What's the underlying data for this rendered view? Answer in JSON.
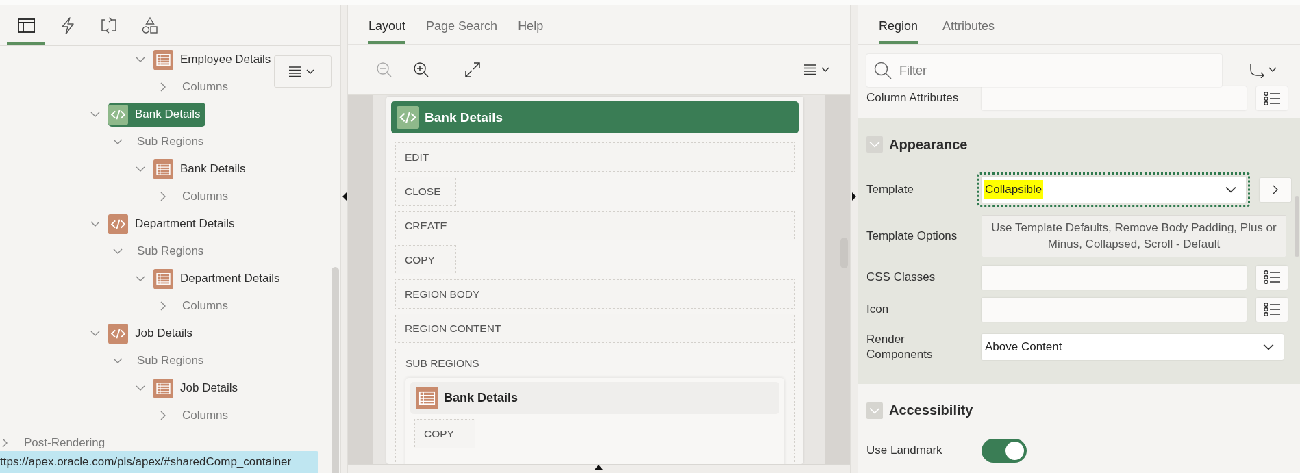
{
  "navigator": {
    "tabs": [
      {
        "kind": "rendering",
        "selected": true
      },
      {
        "kind": "dynamic-actions",
        "selected": false
      },
      {
        "kind": "processing",
        "selected": false
      },
      {
        "kind": "shared-components",
        "selected": false
      }
    ],
    "tree": [
      {
        "label": "Employee Details",
        "kind": "table",
        "expanded": true,
        "selected": false,
        "children": [
          {
            "label": "Columns",
            "kind": "folder",
            "expanded": false,
            "selected": false
          }
        ]
      },
      {
        "label": "Bank Details",
        "kind": "region",
        "expanded": true,
        "selected": true,
        "children": [
          {
            "label": "Sub Regions",
            "kind": "folder",
            "expanded": true,
            "selected": false,
            "children": [
              {
                "label": "Bank Details",
                "kind": "table",
                "expanded": true,
                "selected": false,
                "children": [
                  {
                    "label": "Columns",
                    "kind": "folder",
                    "expanded": false,
                    "selected": false
                  }
                ]
              }
            ]
          }
        ]
      },
      {
        "label": "Department Details",
        "kind": "region",
        "expanded": true,
        "selected": false,
        "children": [
          {
            "label": "Sub Regions",
            "kind": "folder",
            "expanded": true,
            "selected": false,
            "children": [
              {
                "label": "Department Details",
                "kind": "table",
                "expanded": true,
                "selected": false,
                "children": [
                  {
                    "label": "Columns",
                    "kind": "folder",
                    "expanded": false,
                    "selected": false
                  }
                ]
              }
            ]
          }
        ]
      },
      {
        "label": "Job Details",
        "kind": "region",
        "expanded": true,
        "selected": false,
        "children": [
          {
            "label": "Sub Regions",
            "kind": "folder",
            "expanded": true,
            "selected": false,
            "children": [
              {
                "label": "Job Details",
                "kind": "table",
                "expanded": true,
                "selected": false,
                "children": [
                  {
                    "label": "Columns",
                    "kind": "folder",
                    "expanded": false,
                    "selected": false
                  }
                ]
              }
            ]
          }
        ]
      },
      {
        "label": "Post-Rendering",
        "kind": "section",
        "expanded": false,
        "selected": false
      }
    ],
    "status_url": "ttps://apex.oracle.com/pls/apex/#sharedComp_container"
  },
  "layout": {
    "tabs": [
      {
        "label": "Layout",
        "selected": true
      },
      {
        "label": "Page Search",
        "selected": false
      },
      {
        "label": "Help",
        "selected": false
      }
    ],
    "toolbar": [
      {
        "kind": "zoom-out",
        "disabled": true
      },
      {
        "kind": "zoom-in",
        "disabled": false
      },
      {
        "kind": "expand",
        "disabled": false
      }
    ],
    "region": {
      "title": "Bank Details",
      "kind": "region",
      "selected": true,
      "slots": [
        {
          "label": "EDIT",
          "kind": "wide"
        },
        {
          "label": "CLOSE",
          "kind": "narrow"
        },
        {
          "label": "CREATE",
          "kind": "wide"
        },
        {
          "label": "COPY",
          "kind": "narrow"
        },
        {
          "label": "REGION BODY",
          "kind": "wide"
        },
        {
          "label": "REGION CONTENT",
          "kind": "wide"
        },
        {
          "label": "SUB REGIONS",
          "kind": "container",
          "regions": [
            {
              "title": "Bank Details",
              "kind": "table",
              "selected": false,
              "slots": [
                {
                  "label": "COPY",
                  "kind": "narrow"
                }
              ]
            }
          ]
        }
      ]
    }
  },
  "property_editor": {
    "tabs": [
      {
        "label": "Region",
        "selected": true
      },
      {
        "label": "Attributes",
        "selected": false
      }
    ],
    "filter": {
      "placeholder": "Filter"
    },
    "groups": [
      {
        "rows": [
          {
            "label": "Column Attributes",
            "kind": "text"
          }
        ]
      },
      {
        "title": "Appearance",
        "expanded": true,
        "current": true,
        "rows": [
          {
            "label": "Template",
            "kind": "picker",
            "value": "Collapsible",
            "highlighted": true,
            "focused": true
          },
          {
            "label": "Template Options",
            "kind": "options",
            "value": "Use Template Defaults, Remove Body Padding, Plus or Minus, Collapsed, Scroll - Default"
          },
          {
            "label": "CSS Classes",
            "kind": "text"
          },
          {
            "label": "Icon",
            "kind": "text"
          },
          {
            "label": "Render Components",
            "kind": "select",
            "value": "Above Content",
            "highlighted": false,
            "focused": false
          }
        ]
      },
      {
        "title": "Accessibility",
        "expanded": true,
        "rows": [
          {
            "label": "Use Landmark",
            "kind": "switch",
            "on": true
          }
        ]
      }
    ]
  }
}
